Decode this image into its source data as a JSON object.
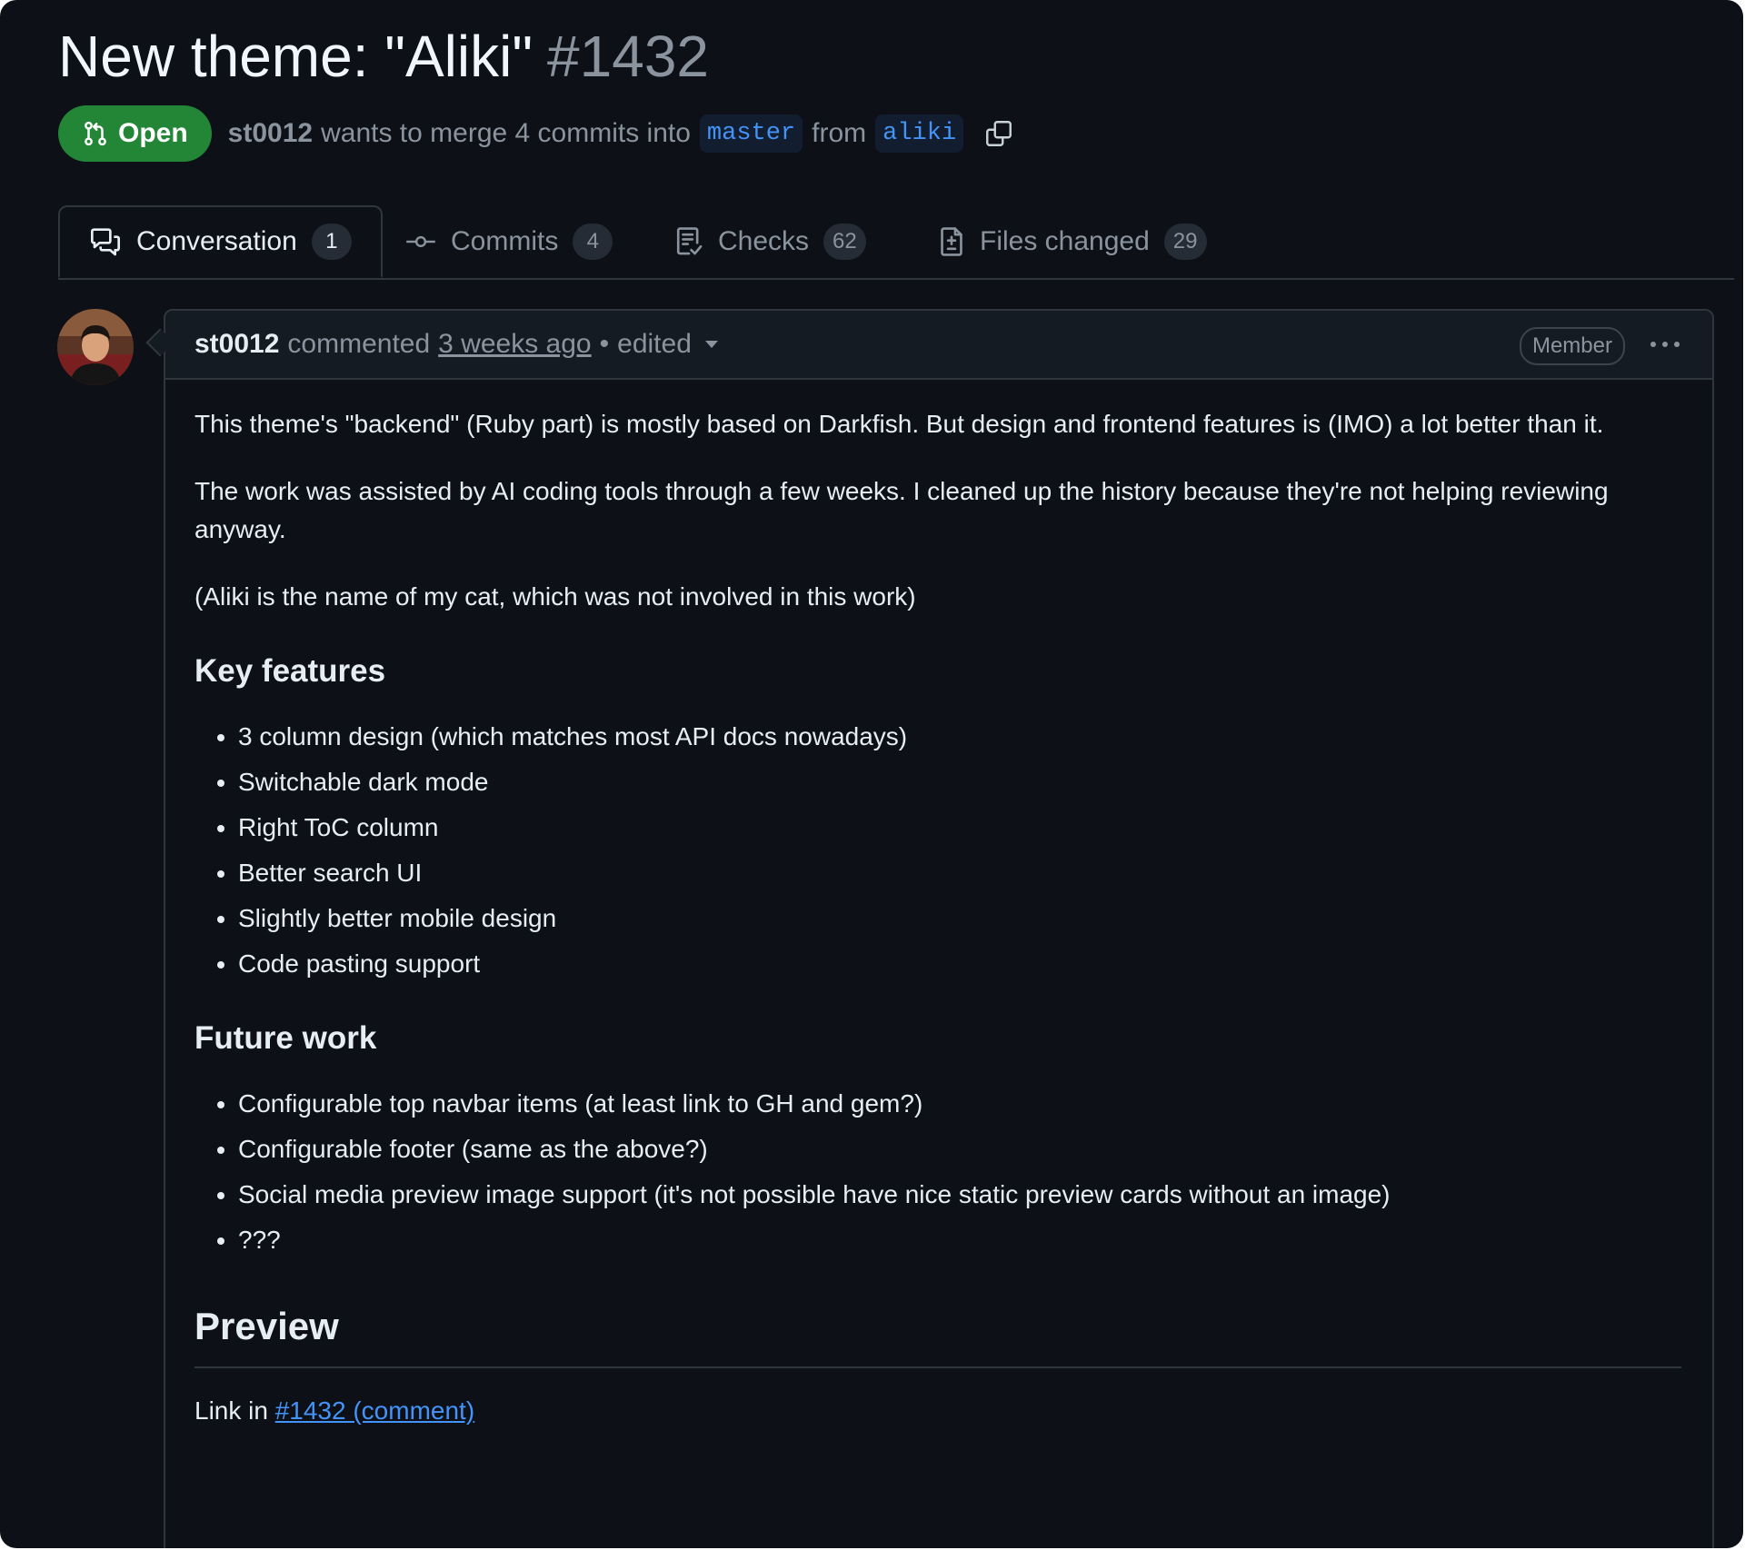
{
  "pr": {
    "title": "New theme: \"Aliki\"",
    "number": "#1432",
    "state": "Open",
    "author": "st0012",
    "merge_text": "wants to merge 4 commits into",
    "base_branch": "master",
    "from_text": "from",
    "head_branch": "aliki"
  },
  "tabs": [
    {
      "label": "Conversation",
      "count": "1",
      "icon": "comment-discussion-icon"
    },
    {
      "label": "Commits",
      "count": "4",
      "icon": "git-commit-icon"
    },
    {
      "label": "Checks",
      "count": "62",
      "icon": "checklist-icon"
    },
    {
      "label": "Files changed",
      "count": "29",
      "icon": "file-diff-icon"
    }
  ],
  "comment": {
    "author": "st0012",
    "action": "commented",
    "time": "3 weeks ago",
    "separator": "•",
    "edited": "edited",
    "badge": "Member",
    "paragraphs": [
      "This theme's \"backend\" (Ruby part) is mostly based on Darkfish. But design and frontend features is (IMO) a lot better than it.",
      "The work was assisted by AI coding tools through a few weeks. I cleaned up the history because they're not helping reviewing anyway.",
      "(Aliki is the name of my cat, which was not involved in this work)"
    ],
    "key_features_heading": "Key features",
    "key_features": [
      "3 column design (which matches most API docs nowadays)",
      "Switchable dark mode",
      "Right ToC column",
      "Better search UI",
      "Slightly better mobile design",
      "Code pasting support"
    ],
    "future_work_heading": "Future work",
    "future_work": [
      "Configurable top navbar items (at least link to GH and gem?)",
      "Configurable footer (same as the above?)",
      "Social media preview image support (it's not possible have nice static preview cards without an image)",
      "???"
    ],
    "preview_heading": "Preview",
    "link_prefix": "Link in",
    "link_text": "#1432 (comment)"
  },
  "colors": {
    "background": "#0d1117",
    "open_badge": "#238636",
    "link": "#4493f8",
    "border": "#30363d",
    "muted_text": "#8b949e"
  }
}
